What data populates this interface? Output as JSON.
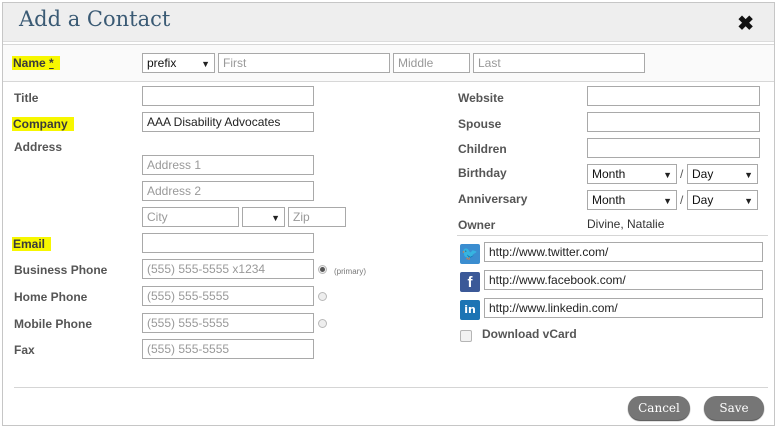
{
  "dialog": {
    "title": "Add a Contact"
  },
  "labels": {
    "name": "Name",
    "required": "*",
    "title": "Title",
    "company": "Company",
    "address": "Address",
    "email": "Email",
    "business_phone": "Business Phone",
    "home_phone": "Home Phone",
    "mobile_phone": "Mobile Phone",
    "fax": "Fax",
    "website": "Website",
    "spouse": "Spouse",
    "children": "Children",
    "birthday": "Birthday",
    "anniversary": "Anniversary",
    "owner": "Owner",
    "primary": "(primary)",
    "download_vcard": "Download vCard"
  },
  "name": {
    "prefix": "prefix",
    "first_placeholder": "First",
    "middle_placeholder": "Middle",
    "last_placeholder": "Last"
  },
  "company": {
    "value": "AAA Disability Advocates"
  },
  "address": {
    "line1_placeholder": "Address 1",
    "line2_placeholder": "Address 2",
    "city_placeholder": "City",
    "state_value": "",
    "zip_placeholder": "Zip"
  },
  "phones": {
    "business_placeholder": "(555) 555-5555 x1234",
    "home_placeholder": "(555) 555-5555",
    "mobile_placeholder": "(555) 555-5555",
    "fax_placeholder": "(555) 555-5555"
  },
  "dates": {
    "birthday_month": "Month",
    "birthday_day": "Day",
    "anniversary_month": "Month",
    "anniversary_day": "Day",
    "separator": "/"
  },
  "owner": {
    "value": "Divine, Natalie"
  },
  "social": {
    "twitter": "http://www.twitter.com/",
    "facebook": "http://www.facebook.com/",
    "linkedin": "http://www.linkedin.com/",
    "twitter_glyph": "🐦",
    "facebook_glyph": "f",
    "linkedin_glyph": "in"
  },
  "icons": {
    "close": "✖",
    "dropdown": "▼"
  },
  "buttons": {
    "cancel": "Cancel",
    "save": "Save"
  },
  "colors": {
    "highlight": "#f7f700",
    "title": "#3a5a74",
    "button": "#767676"
  }
}
